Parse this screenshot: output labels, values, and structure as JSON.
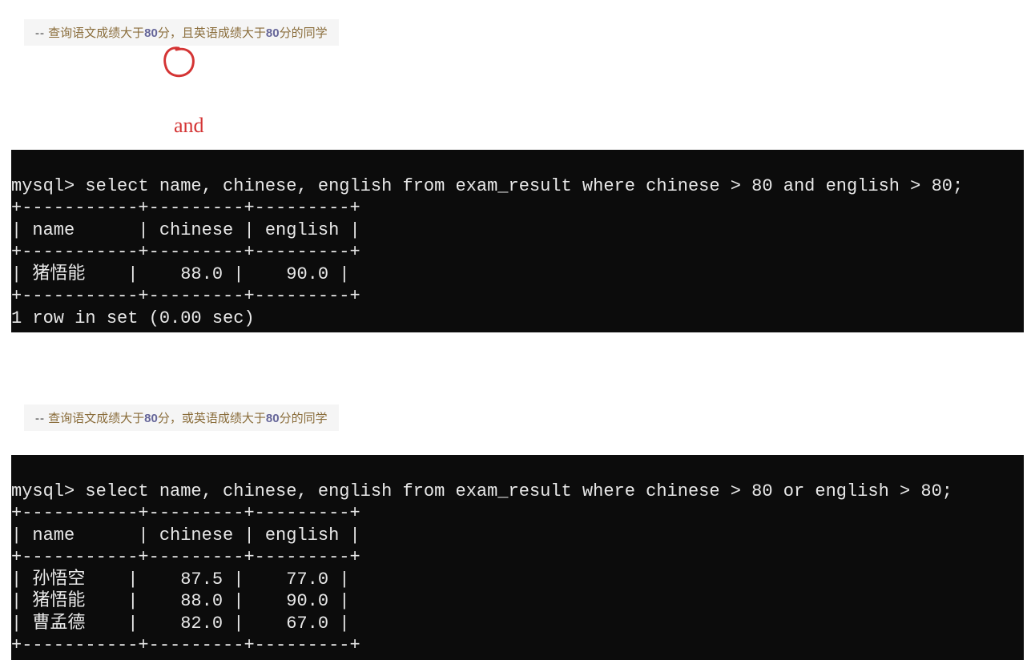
{
  "block1": {
    "comment_dash": "--",
    "comment_pre": "  查询语文成绩大于",
    "num1": "80",
    "comment_mid1": "分，且英语成绩大于",
    "num2": "80",
    "comment_end": "分的同学",
    "annotation": "and",
    "terminal": {
      "prompt_line": "mysql> select name, chinese, english from exam_result where chinese > 80 and english > 80;",
      "border": "+-----------+---------+---------+",
      "header": "| name      | chinese | english |",
      "rows": [
        "| 猪悟能    |    88.0 |    90.0 |"
      ],
      "footer": "1 row in set (0.00 sec)"
    }
  },
  "block2": {
    "comment_dash": "--",
    "comment_pre": "  查询语文成绩大于",
    "num1": "80",
    "comment_mid1": "分，或英语成绩大于",
    "num2": "80",
    "comment_end": "分的同学",
    "terminal": {
      "prompt_line": "mysql> select name, chinese, english from exam_result where chinese > 80 or english > 80;",
      "border": "+-----------+---------+---------+",
      "header": "| name      | chinese | english |",
      "rows": [
        "| 孙悟空    |    87.5 |    77.0 |",
        "| 猪悟能    |    88.0 |    90.0 |",
        "| 曹孟德    |    82.0 |    67.0 |"
      ]
    }
  }
}
